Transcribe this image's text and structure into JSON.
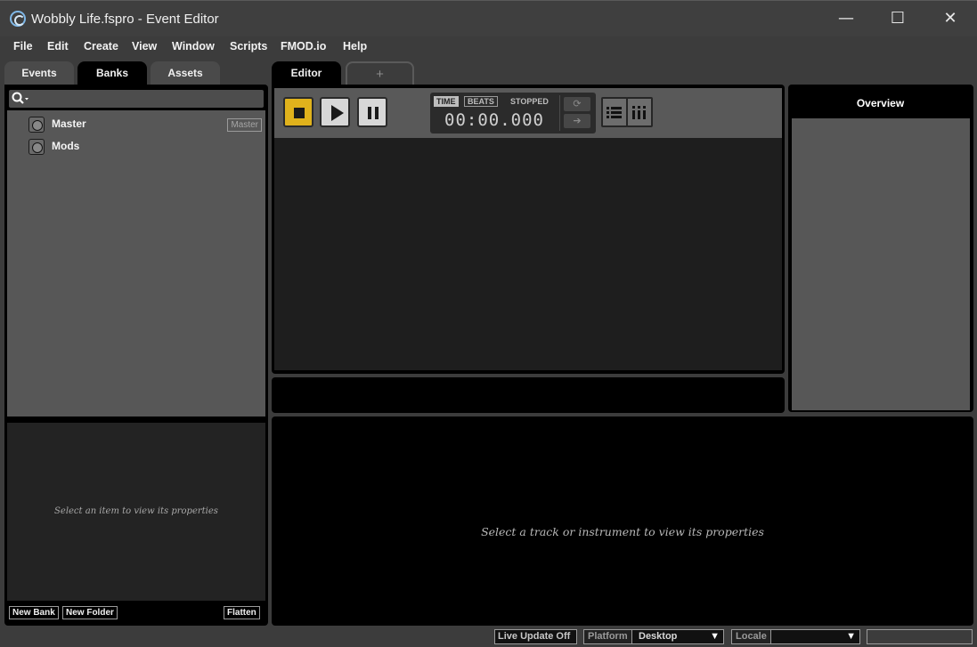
{
  "window": {
    "title": "Wobbly Life.fspro - Event Editor",
    "minimize": "—",
    "maximize": "☐",
    "close": "✕"
  },
  "menu": [
    "File",
    "Edit",
    "Create",
    "View",
    "Window",
    "Scripts",
    "FMOD.io",
    "Help"
  ],
  "browser": {
    "tabs": [
      "Events",
      "Banks",
      "Assets"
    ],
    "active_tab": "Banks",
    "search": {
      "value": "",
      "icon": "search-icon"
    },
    "banks": [
      {
        "label": "Master",
        "badge": "Master"
      },
      {
        "label": "Mods",
        "badge": ""
      }
    ],
    "properties_placeholder": "Select an item to view its properties",
    "buttons": {
      "new_bank": "New Bank",
      "new_folder": "New Folder",
      "flatten": "Flatten"
    }
  },
  "editor": {
    "tabs": [
      "Editor",
      "+"
    ],
    "active_tab": "Editor",
    "transport": {
      "time_label": "TIME",
      "beats_label": "BEATS",
      "state": "STOPPED",
      "time": "00:00.000"
    },
    "properties_placeholder": "Select a track or instrument to view its properties"
  },
  "overview": {
    "title": "Overview"
  },
  "status_bar": {
    "live_update": "Live Update Off",
    "platform_label": "Platform",
    "platform_value": "Desktop",
    "locale_label": "Locale",
    "locale_value": ""
  },
  "colors": {
    "accent_stop": "#e0b21c",
    "panel_bg": "#000000",
    "app_bg": "#3c3c3c"
  }
}
